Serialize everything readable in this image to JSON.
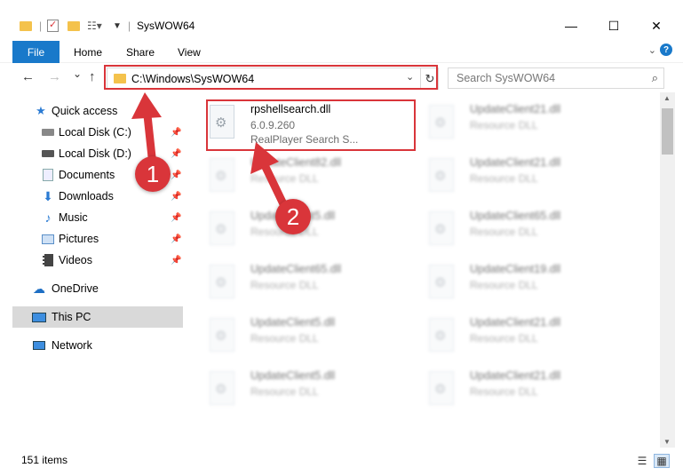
{
  "window": {
    "title": "SysWOW64",
    "minimize": "—",
    "maximize": "☐",
    "close": "✕"
  },
  "ribbon": {
    "tabs": [
      "File",
      "Home",
      "Share",
      "View"
    ],
    "expand_icon": "chevron-down-icon",
    "help": "?"
  },
  "nav": {
    "back": "←",
    "forward": "→",
    "recent": "⌄",
    "up": "↑",
    "address": "C:\\Windows\\SysWOW64",
    "search_placeholder": "Search SysWOW64"
  },
  "sidebar": {
    "items": [
      {
        "label": "Quick access",
        "icon": "star-icon",
        "pinned": false
      },
      {
        "label": "Local Disk (C:)",
        "icon": "drive-icon",
        "pinned": true
      },
      {
        "label": "Local Disk (D:)",
        "icon": "drive-icon",
        "pinned": true
      },
      {
        "label": "Documents",
        "icon": "documents-icon",
        "pinned": true
      },
      {
        "label": "Downloads",
        "icon": "download-icon",
        "pinned": true
      },
      {
        "label": "Music",
        "icon": "music-icon",
        "pinned": true
      },
      {
        "label": "Pictures",
        "icon": "pictures-icon",
        "pinned": true
      },
      {
        "label": "Videos",
        "icon": "videos-icon",
        "pinned": true
      },
      {
        "label": "OneDrive",
        "icon": "cloud-icon",
        "pinned": false
      },
      {
        "label": "This PC",
        "icon": "computer-icon",
        "pinned": false,
        "selected": true
      },
      {
        "label": "Network",
        "icon": "network-icon",
        "pinned": false
      }
    ]
  },
  "files": {
    "highlighted": {
      "name": "rpshellsearch.dll",
      "version": "6.0.9.260",
      "description": "RealPlayer Search S..."
    },
    "left_column": [
      {
        "name": "UpdateClient82.dll",
        "description": "Resource DLL"
      },
      {
        "name": "UpdateClient5.dll",
        "description": "Resource DLL"
      },
      {
        "name": "UpdateClient65.dll",
        "description": "Resource DLL"
      },
      {
        "name": "UpdateClient5.dll",
        "description": "Resource DLL"
      },
      {
        "name": "UpdateClient5.dll",
        "description": "Resource DLL"
      }
    ],
    "right_column": [
      {
        "name": "UpdateClient21.dll",
        "description": "Resource DLL"
      },
      {
        "name": "UpdateClient21.dll",
        "description": "Resource DLL"
      },
      {
        "name": "UpdateClient65.dll",
        "description": "Resource DLL"
      },
      {
        "name": "UpdateClient19.dll",
        "description": "Resource DLL"
      },
      {
        "name": "UpdateClient21.dll",
        "description": "Resource DLL"
      },
      {
        "name": "UpdateClient21.dll",
        "description": "Resource DLL"
      }
    ]
  },
  "annotations": {
    "badge1": "1",
    "badge2": "2",
    "color": "#d9353a"
  },
  "status": {
    "item_count": "151 items"
  }
}
